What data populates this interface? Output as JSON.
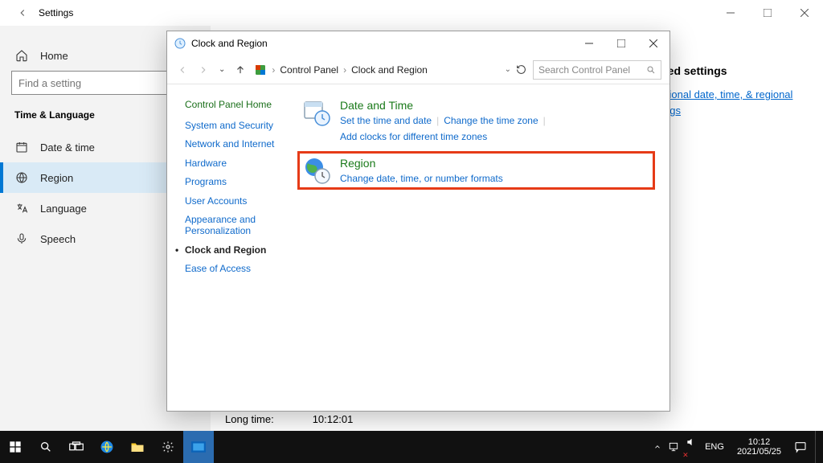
{
  "settings": {
    "title": "Settings",
    "search_placeholder": "Find a setting",
    "section": "Time & Language",
    "home": "Home",
    "nav": [
      {
        "label": "Date & time"
      },
      {
        "label": "Region"
      },
      {
        "label": "Language"
      },
      {
        "label": "Speech"
      }
    ],
    "related_heading": "ted settings",
    "related_link_1": "itional date, time, & regional",
    "related_link_2": "ngs",
    "long_time_label": "Long time:",
    "long_time_value": "10:12:01"
  },
  "cp": {
    "title": "Clock and Region",
    "breadcrumb": [
      "Control Panel",
      "Clock and Region"
    ],
    "search_placeholder": "Search Control Panel",
    "side_home": "Control Panel Home",
    "side_links": [
      "System and Security",
      "Network and Internet",
      "Hardware",
      "Programs",
      "User Accounts",
      "Appearance and Personalization",
      "Clock and Region",
      "Ease of Access"
    ],
    "items": [
      {
        "title": "Date and Time",
        "links": [
          "Set the time and date",
          "Change the time zone",
          "Add clocks for different time zones"
        ]
      },
      {
        "title": "Region",
        "links": [
          "Change date, time, or number formats"
        ]
      }
    ]
  },
  "taskbar": {
    "lang": "ENG",
    "time": "10:12",
    "date": "2021/05/25"
  }
}
